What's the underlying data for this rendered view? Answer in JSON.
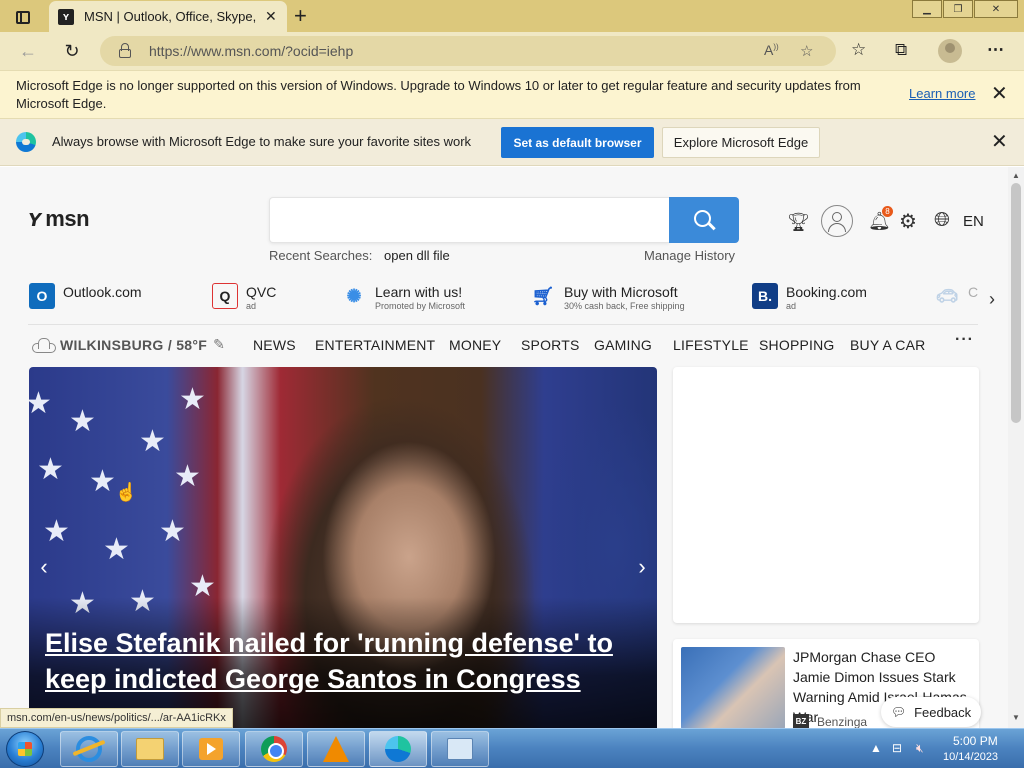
{
  "browser": {
    "tab_title": "MSN | Outlook, Office, Skype, Bing",
    "tab_favicon": "msn-logo-icon",
    "url": "https://www.msn.com/?ocid=iehp",
    "window_controls": [
      "minimize",
      "restore",
      "close"
    ]
  },
  "infobar_unsupported": {
    "message": "Microsoft Edge is no longer supported on this version of Windows. Upgrade to Windows 10 or later to get regular feature and security updates from Microsoft Edge.",
    "learn_more": "Learn more"
  },
  "infobar_default": {
    "message": "Always browse with Microsoft Edge to make sure your favorite sites work",
    "primary_button": "Set as default browser",
    "secondary_button": "Explore Microsoft Edge"
  },
  "header": {
    "logo_text": "msn",
    "search_placeholder": "",
    "recent_label": "Recent Searches:",
    "recent_items": [
      "open dll file"
    ],
    "manage_history": "Manage History",
    "notification_count": "8",
    "language": "EN"
  },
  "quick_links": [
    {
      "title": "Outlook.com",
      "subtitle": "",
      "icon": "outlook-icon"
    },
    {
      "title": "QVC",
      "subtitle": "ad",
      "icon": "qvc-icon"
    },
    {
      "title": "Learn with us!",
      "subtitle": "Promoted by Microsoft",
      "icon": "lightbulb-icon"
    },
    {
      "title": "Buy with Microsoft",
      "subtitle": "30% cash back, Free shipping",
      "icon": "cart-icon"
    },
    {
      "title": "Booking.com",
      "subtitle": "ad",
      "icon": "booking-icon"
    },
    {
      "title": "C",
      "subtitle": "",
      "icon": "car-icon"
    }
  ],
  "weather": {
    "location": "WILKINSBURG / 58°F"
  },
  "nav": [
    "NEWS",
    "ENTERTAINMENT",
    "MONEY",
    "SPORTS",
    "GAMING",
    "LIFESTYLE",
    "SHOPPING",
    "BUY A CAR"
  ],
  "hero": {
    "headline": "Elise Stefanik nailed for 'running defense' to keep indicted George Santos in Congress"
  },
  "side_story": {
    "title": "JPMorgan Chase CEO Jamie Dimon Issues Stark Warning Amid Israel-Hamas War",
    "source_badge": "BZ",
    "source": "Benzinga"
  },
  "feedback_label": "Feedback",
  "status_url": "msn.com/en-us/news/politics/.../ar-AA1icRKx",
  "taskbar": {
    "apps": [
      "internet-explorer",
      "file-explorer",
      "media-player",
      "chrome",
      "vlc",
      "edge",
      "network"
    ],
    "time": "5:00 PM",
    "date": "10/14/2023"
  }
}
